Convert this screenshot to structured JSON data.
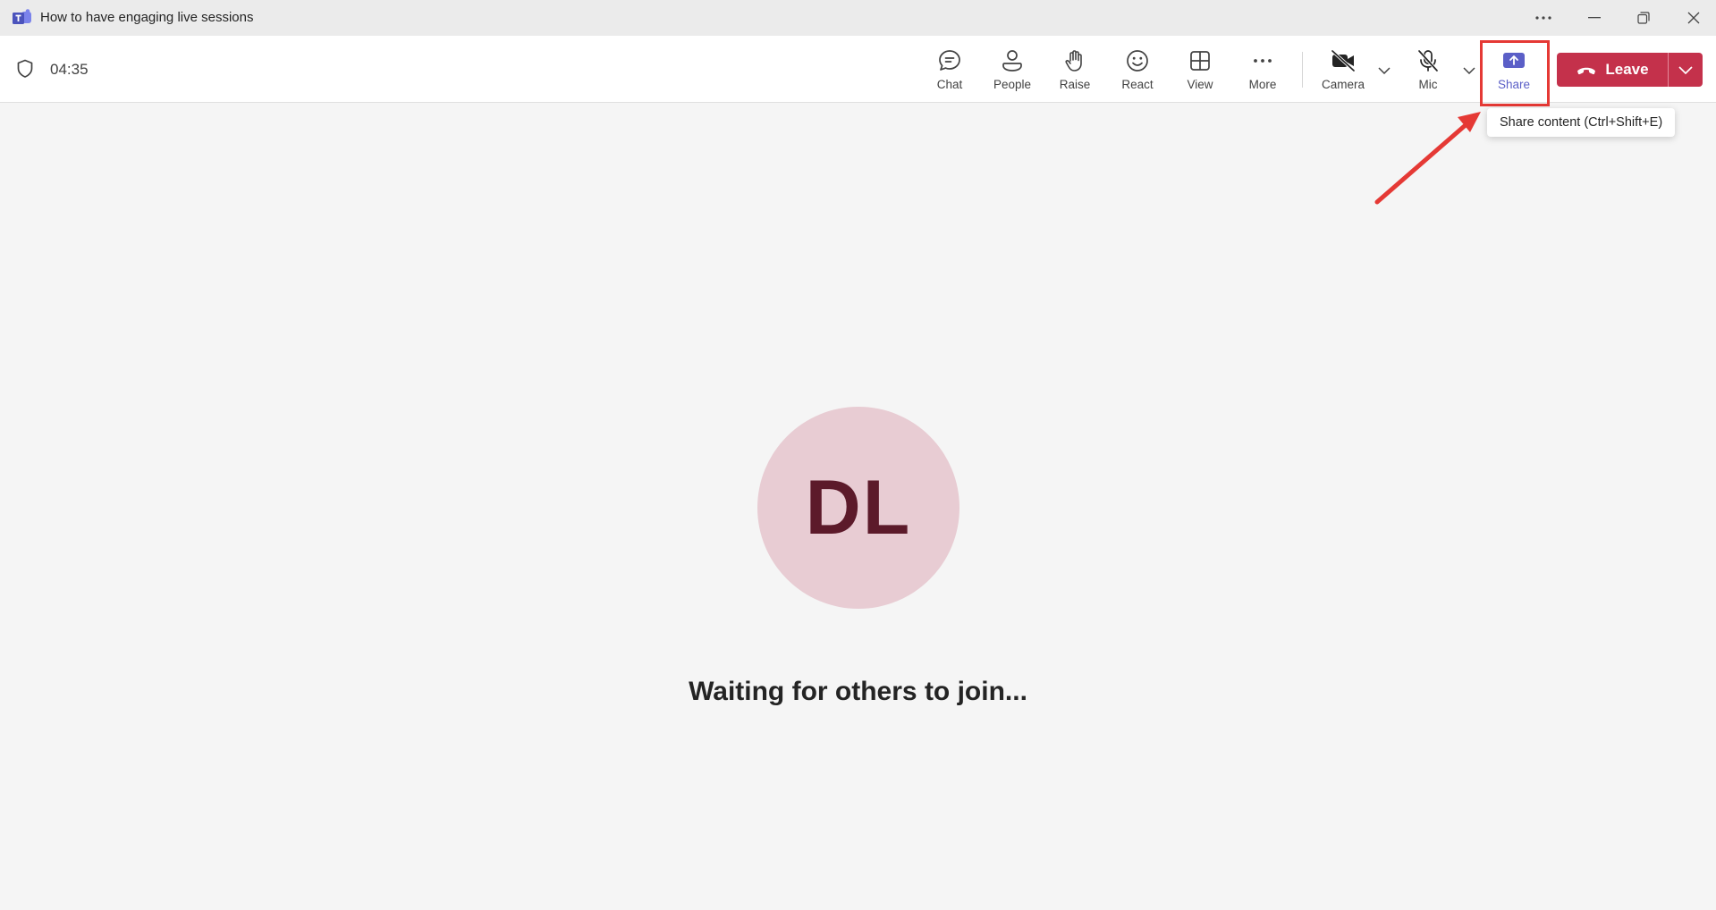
{
  "window": {
    "title": "How to have engaging live sessions",
    "app_icon": "teams-logo-icon",
    "controls": [
      "more-options-icon",
      "minimize-icon",
      "restore-icon",
      "close-icon"
    ]
  },
  "meeting": {
    "timer": "04:35",
    "toolbar": {
      "chat_label": "Chat",
      "people_label": "People",
      "raise_label": "Raise",
      "react_label": "React",
      "view_label": "View",
      "more_label": "More",
      "camera_label": "Camera",
      "mic_label": "Mic",
      "share_label": "Share",
      "leave_label": "Leave"
    },
    "tooltip": "Share content (Ctrl+Shift+E)"
  },
  "stage": {
    "avatar_initials": "DL",
    "status_message": "Waiting for others to join..."
  },
  "colors": {
    "accent": "#5b5fc7",
    "leave": "#c4314b",
    "highlight": "#e53935",
    "avatar_bg": "#e8ccd3",
    "avatar_text": "#5c1a2a"
  }
}
